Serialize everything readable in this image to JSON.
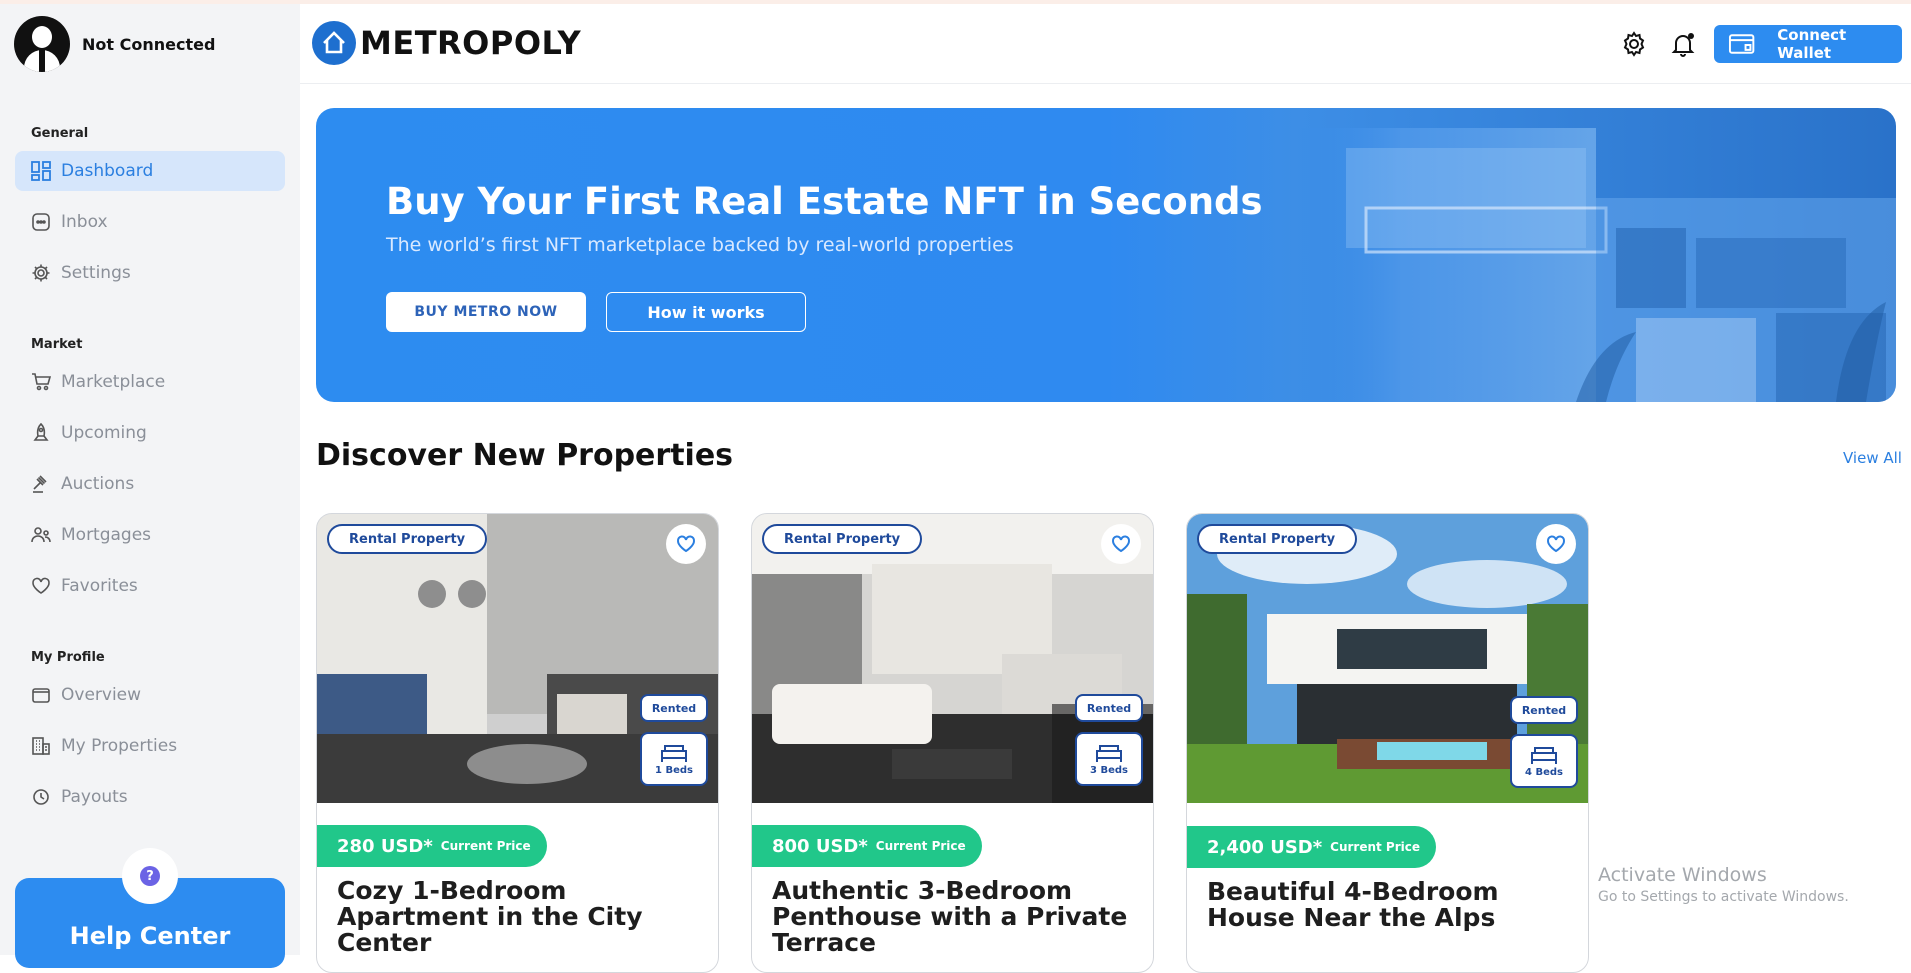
{
  "user": {
    "status": "Not Connected"
  },
  "sidebar": {
    "general_title": "General",
    "general_items": [
      {
        "label": "Dashboard",
        "icon": "dashboard-icon",
        "active": true
      },
      {
        "label": "Inbox",
        "icon": "inbox-icon"
      },
      {
        "label": "Settings",
        "icon": "gear-icon"
      }
    ],
    "market_title": "Market",
    "market_items": [
      {
        "label": "Marketplace",
        "icon": "cart-icon"
      },
      {
        "label": "Upcoming",
        "icon": "rocket-icon"
      },
      {
        "label": "Auctions",
        "icon": "gavel-icon"
      },
      {
        "label": "Mortgages",
        "icon": "people-icon"
      },
      {
        "label": "Favorites",
        "icon": "heart-icon"
      }
    ],
    "profile_title": "My Profile",
    "profile_items": [
      {
        "label": "Overview",
        "icon": "wallet-icon"
      },
      {
        "label": "My Properties",
        "icon": "building-icon"
      },
      {
        "label": "Payouts",
        "icon": "payout-icon"
      }
    ],
    "help": {
      "badge": "?",
      "title": "Help Center"
    }
  },
  "header": {
    "logo_text": "METROPOLY",
    "connect_label": "Connect Wallet"
  },
  "hero": {
    "title": "Buy Your First Real Estate NFT in Seconds",
    "subtitle": "The world’s first NFT marketplace backed by real-world properties",
    "buy_label": "BUY METRO NOW",
    "how_label": "How it works"
  },
  "properties": {
    "title": "Discover New Properties",
    "view_all": "View All",
    "cards": [
      {
        "tag": "Rental Property",
        "status": "Rented",
        "beds": "1 Beds",
        "price": "280 USD*",
        "price_label": "Current Price",
        "title": "Cozy 1-Bedroom Apartment in the City Center"
      },
      {
        "tag": "Rental Property",
        "status": "Rented",
        "beds": "3 Beds",
        "price": "800 USD*",
        "price_label": "Current Price",
        "title": "Authentic 3-Bedroom Penthouse with a Private Terrace"
      },
      {
        "tag": "Rental Property",
        "status": "Rented",
        "beds": "4 Beds",
        "price": "2,400 USD*",
        "price_label": "Current Price",
        "title": "Beautiful 4-Bedroom House Near the Alps"
      }
    ]
  },
  "watermark": {
    "line1": "Activate Windows",
    "line2": "Go to Settings to activate Windows."
  },
  "colors": {
    "accent": "#2d8cf0",
    "price_green": "#21c78a",
    "tag_navy": "#1f4a9b",
    "active_bg": "#d6e6fb"
  }
}
